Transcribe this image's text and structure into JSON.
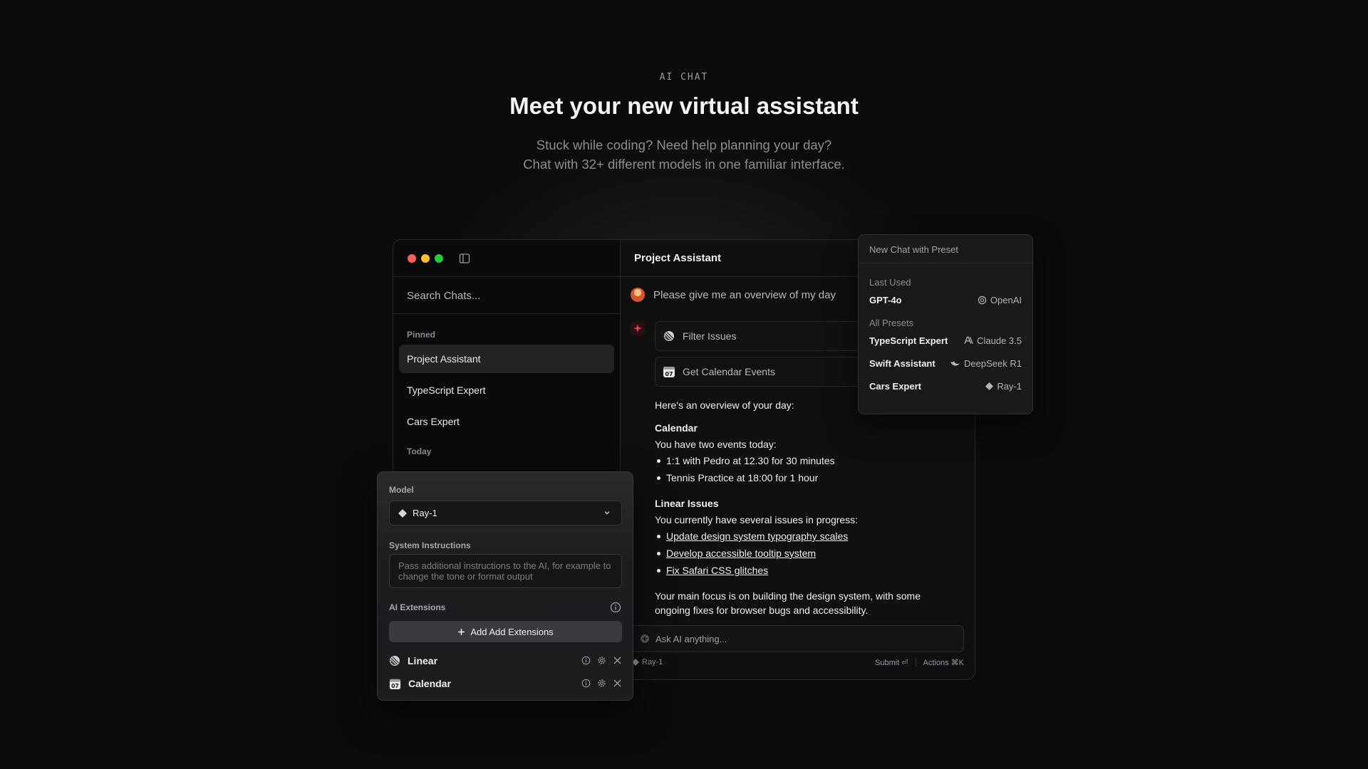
{
  "hero": {
    "eyebrow": "AI CHAT",
    "title": "Meet your new virtual assistant",
    "subtitle_line1": "Stuck while coding? Need help planning your day?",
    "subtitle_line2": "Chat with 32+ different models in one familiar interface."
  },
  "sidebar": {
    "search_placeholder": "Search Chats...",
    "pinned_label": "Pinned",
    "pinned_items": [
      "Project Assistant",
      "TypeScript Expert",
      "Cars Expert"
    ],
    "today_label": "Today"
  },
  "chat": {
    "title": "Project Assistant",
    "user_message": "Please give me an overview of my day",
    "tools": [
      "Filter Issues",
      "Get Calendar Events"
    ],
    "answer": {
      "intro": "Here's an overview of your day:",
      "calendar_heading": "Calendar",
      "calendar_text": "You have two events today:",
      "calendar_items": [
        "1:1 with Pedro at 12.30 for 30 minutes",
        "Tennis Practice at 18:00 for 1 hour"
      ],
      "linear_heading": "Linear Issues",
      "linear_text": "You currently have several issues in progress:",
      "linear_items": [
        "Update design system typography scales",
        "Develop accessible tooltip system",
        "Fix Safari CSS glitches"
      ],
      "summary": "Your main focus is on building the design system, with some ongoing fixes for browser bugs and accessibility."
    },
    "composer_placeholder": "Ask AI anything...",
    "footer_model": "Ray-1",
    "submit_label": "Submit ⏎",
    "actions_label": "Actions ⌘K"
  },
  "presets": {
    "header": "New Chat with Preset",
    "last_used_label": "Last Used",
    "last_used": {
      "name": "GPT-4o",
      "provider": "OpenAI"
    },
    "all_label": "All Presets",
    "items": [
      {
        "name": "TypeScript Expert",
        "model": "Claude 3.5"
      },
      {
        "name": "Swift Assistant",
        "model": "DeepSeek R1"
      },
      {
        "name": "Cars Expert",
        "model": "Ray-1"
      }
    ]
  },
  "settings": {
    "model_label": "Model",
    "model_value": "Ray-1",
    "system_label": "System Instructions",
    "system_placeholder": "Pass additional instructions to the AI, for example to change the tone or format output",
    "extensions_label": "AI Extensions",
    "add_button": "Add Add Extensions",
    "extensions": [
      "Linear",
      "Calendar"
    ]
  },
  "colors": {
    "close": "#fe5f57",
    "minimize": "#febc2e",
    "maximize": "#28c840",
    "accent_red": "#ff3b4e"
  }
}
